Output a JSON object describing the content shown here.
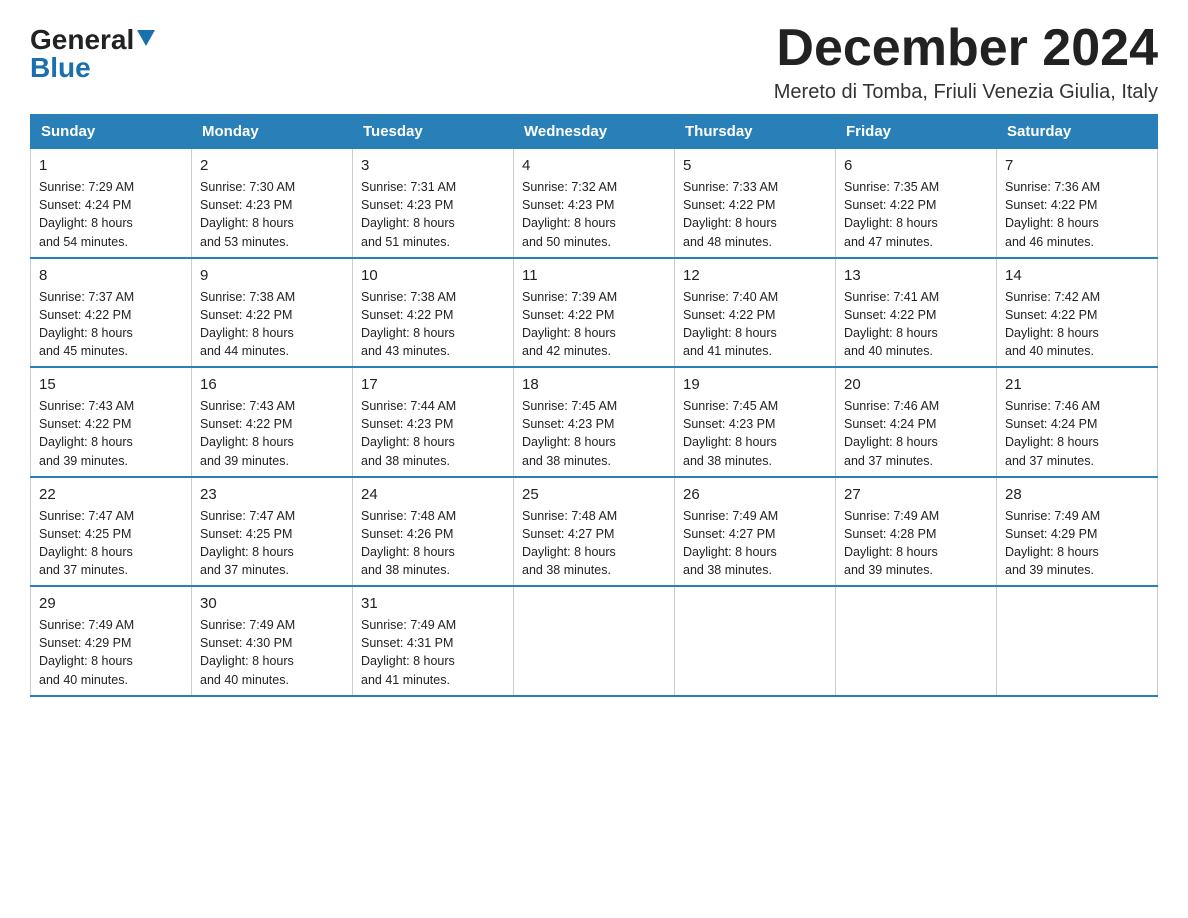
{
  "logo": {
    "general": "General",
    "blue": "Blue",
    "triangle": "▼"
  },
  "title": "December 2024",
  "location": "Mereto di Tomba, Friuli Venezia Giulia, Italy",
  "days_of_week": [
    "Sunday",
    "Monday",
    "Tuesday",
    "Wednesday",
    "Thursday",
    "Friday",
    "Saturday"
  ],
  "weeks": [
    [
      {
        "day": "1",
        "sunrise": "Sunrise: 7:29 AM",
        "sunset": "Sunset: 4:24 PM",
        "daylight": "Daylight: 8 hours and 54 minutes."
      },
      {
        "day": "2",
        "sunrise": "Sunrise: 7:30 AM",
        "sunset": "Sunset: 4:23 PM",
        "daylight": "Daylight: 8 hours and 53 minutes."
      },
      {
        "day": "3",
        "sunrise": "Sunrise: 7:31 AM",
        "sunset": "Sunset: 4:23 PM",
        "daylight": "Daylight: 8 hours and 51 minutes."
      },
      {
        "day": "4",
        "sunrise": "Sunrise: 7:32 AM",
        "sunset": "Sunset: 4:23 PM",
        "daylight": "Daylight: 8 hours and 50 minutes."
      },
      {
        "day": "5",
        "sunrise": "Sunrise: 7:33 AM",
        "sunset": "Sunset: 4:22 PM",
        "daylight": "Daylight: 8 hours and 48 minutes."
      },
      {
        "day": "6",
        "sunrise": "Sunrise: 7:35 AM",
        "sunset": "Sunset: 4:22 PM",
        "daylight": "Daylight: 8 hours and 47 minutes."
      },
      {
        "day": "7",
        "sunrise": "Sunrise: 7:36 AM",
        "sunset": "Sunset: 4:22 PM",
        "daylight": "Daylight: 8 hours and 46 minutes."
      }
    ],
    [
      {
        "day": "8",
        "sunrise": "Sunrise: 7:37 AM",
        "sunset": "Sunset: 4:22 PM",
        "daylight": "Daylight: 8 hours and 45 minutes."
      },
      {
        "day": "9",
        "sunrise": "Sunrise: 7:38 AM",
        "sunset": "Sunset: 4:22 PM",
        "daylight": "Daylight: 8 hours and 44 minutes."
      },
      {
        "day": "10",
        "sunrise": "Sunrise: 7:38 AM",
        "sunset": "Sunset: 4:22 PM",
        "daylight": "Daylight: 8 hours and 43 minutes."
      },
      {
        "day": "11",
        "sunrise": "Sunrise: 7:39 AM",
        "sunset": "Sunset: 4:22 PM",
        "daylight": "Daylight: 8 hours and 42 minutes."
      },
      {
        "day": "12",
        "sunrise": "Sunrise: 7:40 AM",
        "sunset": "Sunset: 4:22 PM",
        "daylight": "Daylight: 8 hours and 41 minutes."
      },
      {
        "day": "13",
        "sunrise": "Sunrise: 7:41 AM",
        "sunset": "Sunset: 4:22 PM",
        "daylight": "Daylight: 8 hours and 40 minutes."
      },
      {
        "day": "14",
        "sunrise": "Sunrise: 7:42 AM",
        "sunset": "Sunset: 4:22 PM",
        "daylight": "Daylight: 8 hours and 40 minutes."
      }
    ],
    [
      {
        "day": "15",
        "sunrise": "Sunrise: 7:43 AM",
        "sunset": "Sunset: 4:22 PM",
        "daylight": "Daylight: 8 hours and 39 minutes."
      },
      {
        "day": "16",
        "sunrise": "Sunrise: 7:43 AM",
        "sunset": "Sunset: 4:22 PM",
        "daylight": "Daylight: 8 hours and 39 minutes."
      },
      {
        "day": "17",
        "sunrise": "Sunrise: 7:44 AM",
        "sunset": "Sunset: 4:23 PM",
        "daylight": "Daylight: 8 hours and 38 minutes."
      },
      {
        "day": "18",
        "sunrise": "Sunrise: 7:45 AM",
        "sunset": "Sunset: 4:23 PM",
        "daylight": "Daylight: 8 hours and 38 minutes."
      },
      {
        "day": "19",
        "sunrise": "Sunrise: 7:45 AM",
        "sunset": "Sunset: 4:23 PM",
        "daylight": "Daylight: 8 hours and 38 minutes."
      },
      {
        "day": "20",
        "sunrise": "Sunrise: 7:46 AM",
        "sunset": "Sunset: 4:24 PM",
        "daylight": "Daylight: 8 hours and 37 minutes."
      },
      {
        "day": "21",
        "sunrise": "Sunrise: 7:46 AM",
        "sunset": "Sunset: 4:24 PM",
        "daylight": "Daylight: 8 hours and 37 minutes."
      }
    ],
    [
      {
        "day": "22",
        "sunrise": "Sunrise: 7:47 AM",
        "sunset": "Sunset: 4:25 PM",
        "daylight": "Daylight: 8 hours and 37 minutes."
      },
      {
        "day": "23",
        "sunrise": "Sunrise: 7:47 AM",
        "sunset": "Sunset: 4:25 PM",
        "daylight": "Daylight: 8 hours and 37 minutes."
      },
      {
        "day": "24",
        "sunrise": "Sunrise: 7:48 AM",
        "sunset": "Sunset: 4:26 PM",
        "daylight": "Daylight: 8 hours and 38 minutes."
      },
      {
        "day": "25",
        "sunrise": "Sunrise: 7:48 AM",
        "sunset": "Sunset: 4:27 PM",
        "daylight": "Daylight: 8 hours and 38 minutes."
      },
      {
        "day": "26",
        "sunrise": "Sunrise: 7:49 AM",
        "sunset": "Sunset: 4:27 PM",
        "daylight": "Daylight: 8 hours and 38 minutes."
      },
      {
        "day": "27",
        "sunrise": "Sunrise: 7:49 AM",
        "sunset": "Sunset: 4:28 PM",
        "daylight": "Daylight: 8 hours and 39 minutes."
      },
      {
        "day": "28",
        "sunrise": "Sunrise: 7:49 AM",
        "sunset": "Sunset: 4:29 PM",
        "daylight": "Daylight: 8 hours and 39 minutes."
      }
    ],
    [
      {
        "day": "29",
        "sunrise": "Sunrise: 7:49 AM",
        "sunset": "Sunset: 4:29 PM",
        "daylight": "Daylight: 8 hours and 40 minutes."
      },
      {
        "day": "30",
        "sunrise": "Sunrise: 7:49 AM",
        "sunset": "Sunset: 4:30 PM",
        "daylight": "Daylight: 8 hours and 40 minutes."
      },
      {
        "day": "31",
        "sunrise": "Sunrise: 7:49 AM",
        "sunset": "Sunset: 4:31 PM",
        "daylight": "Daylight: 8 hours and 41 minutes."
      },
      null,
      null,
      null,
      null
    ]
  ]
}
